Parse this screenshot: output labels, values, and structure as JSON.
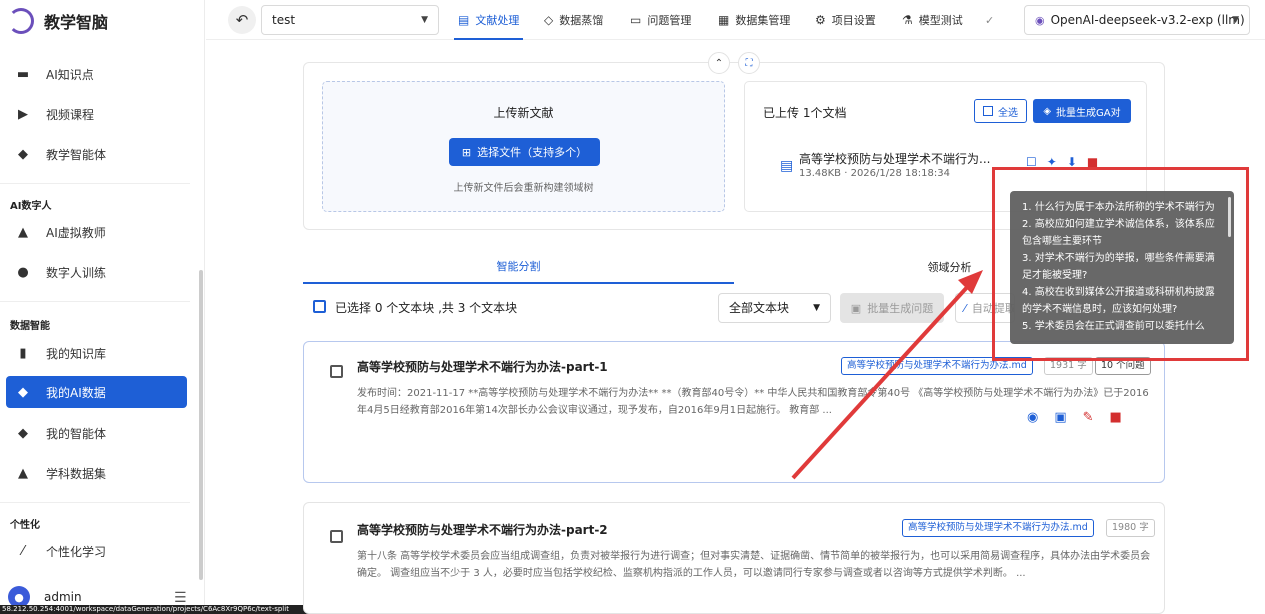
{
  "app": {
    "name": "教学智脑"
  },
  "sidebar": {
    "groups": [
      {
        "title": "",
        "items": [
          {
            "label": "AI知识点",
            "icon": "clapper-icon"
          },
          {
            "label": "视频课程",
            "icon": "video-icon"
          },
          {
            "label": "教学智能体",
            "icon": "cube-icon"
          }
        ]
      },
      {
        "title": "AI数字人",
        "items": [
          {
            "label": "AI虚拟教师",
            "icon": "graduation-cap-icon"
          },
          {
            "label": "数字人训练",
            "icon": "person-icon"
          }
        ]
      },
      {
        "title": "数据智能",
        "items": [
          {
            "label": "我的知识库",
            "icon": "book-icon"
          },
          {
            "label": "我的AI数据",
            "icon": "cube-icon",
            "active": true
          },
          {
            "label": "我的智能体",
            "icon": "cube-icon"
          },
          {
            "label": "学科数据集",
            "icon": "graduation-cap-icon"
          }
        ]
      },
      {
        "title": "个性化",
        "items": [
          {
            "label": "个性化学习",
            "icon": "wand-icon"
          }
        ]
      }
    ],
    "user": {
      "name": "admin"
    }
  },
  "url": "58.212.50.254:4001/workspace/dataGeneration/projects/C6Ac8Xr9QP6c/text-split",
  "topbar": {
    "project": "test",
    "tabs": [
      {
        "label": "文献处理",
        "icon": "document-icon",
        "active": true
      },
      {
        "label": "数据蒸馏",
        "icon": "cube-icon"
      },
      {
        "label": "问题管理",
        "icon": "chat-icon"
      },
      {
        "label": "数据集管理",
        "icon": "grid-icon"
      },
      {
        "label": "项目设置",
        "icon": "gear-icon"
      },
      {
        "label": "模型测试",
        "icon": "flask-icon"
      }
    ],
    "model": "OpenAI-deepseek-v3.2-exp (llm)"
  },
  "upload": {
    "title": "上传新文献",
    "choose_label": "选择文件（支持多个）",
    "hint": "上传新文件后会重新构建领域树"
  },
  "uploaded": {
    "count_label": "已上传 1个文档",
    "select_all": "全选",
    "batch_ga": "批量生成GA对",
    "doc_name": "高等学校预防与处理学术不端行为...",
    "doc_meta": "13.48KB · 2026/1/28 18:18:34"
  },
  "segtabs": {
    "split": "智能分割",
    "domain": "领域分析"
  },
  "filter": {
    "summary": "已选择 0 个文本块 ,共 3 个文本块",
    "select_value": "全部文本块",
    "batch_q": "批量生成问题",
    "auto": "自动提取"
  },
  "chunks": [
    {
      "title": "高等学校预防与处理学术不端行为办法-part-1",
      "file": "高等学校预防与处理学术不端行为办法.md",
      "chars": "1931 字",
      "questions": "10 个问题",
      "body": "发布时间：2021-11-17 **高等学校预防与处理学术不端行为办法** **（教育部40号令）** 中华人民共和国教育部令第40号 《高等学校预防与处理学术不端行为办法》已于2016年4月5日经教育部2016年第14次部长办公会议审议通过，现予发布，自2016年9月1日起施行。 教育部 ..."
    },
    {
      "title": "高等学校预防与处理学术不端行为办法-part-2",
      "file": "高等学校预防与处理学术不端行为办法.md",
      "chars": "1980 字",
      "body": "第十八条 高等学校学术委员会应当组成调查组，负责对被举报行为进行调查；但对事实清楚、证据确凿、情节简单的被举报行为，也可以采用简易调查程序，具体办法由学术委员会确定。 调查组应当不少于 3 人，必要时应当包括学校纪检、监察机构指派的工作人员，可以邀请同行专家参与调查或者以咨询等方式提供学术判断。 ..."
    }
  ],
  "tooltip": {
    "questions": [
      "1. 什么行为属于本办法所称的学术不端行为",
      "2. 高校应如何建立学术诚信体系，该体系应包含哪些主要环节",
      "3. 对学术不端行为的举报，哪些条件需要满足才能被受理?",
      "4. 高校在收到媒体公开报道或科研机构披露的学术不端信息时，应该如何处理?",
      "5. 学术委员会在正式调查前可以委托什么"
    ]
  },
  "colors": {
    "accent": "#1e5fd6",
    "danger": "#d32f2f",
    "annotation": "#e03a3a"
  }
}
